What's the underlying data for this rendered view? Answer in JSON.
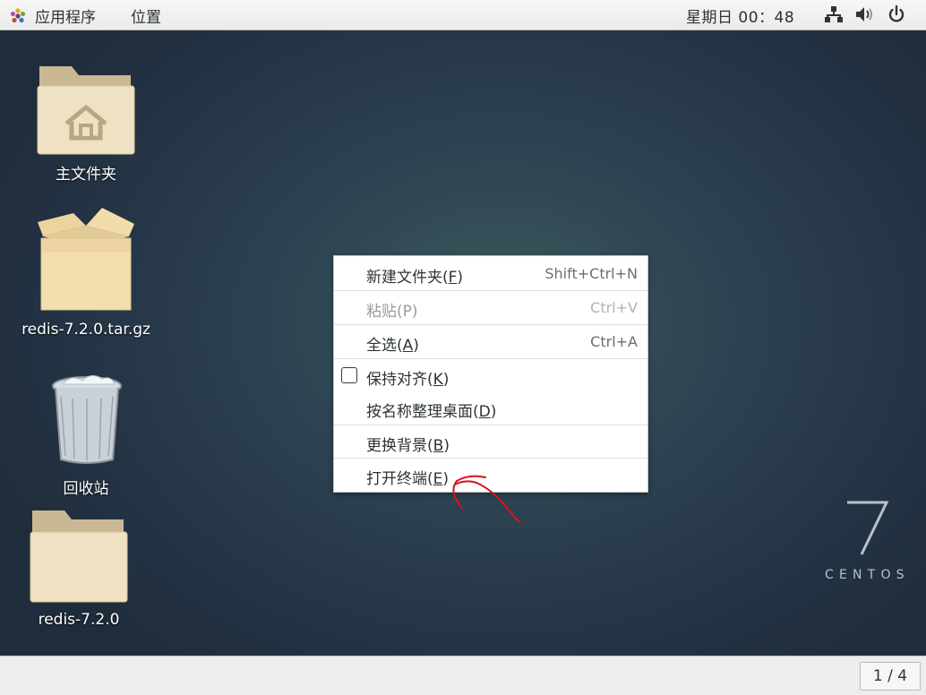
{
  "topbar": {
    "applications_label": "应用程序",
    "places_label": "位置",
    "clock": "星期日 00：48"
  },
  "desktop_icons": [
    {
      "label": "主文件夹",
      "icon": "home-folder-icon"
    },
    {
      "label": "redis-7.2.0.tar.gz",
      "icon": "archive-package-icon"
    },
    {
      "label": "回收站",
      "icon": "trash-icon"
    },
    {
      "label": "redis-7.2.0",
      "icon": "folder-icon"
    }
  ],
  "context_menu": {
    "items": [
      {
        "label": "新建文件夹(",
        "mnemonic": "F",
        "label_end": ")",
        "shortcut": "Shift+Ctrl+N",
        "enabled": true
      },
      {
        "label": "粘贴(P)",
        "mnemonic": "",
        "label_end": "",
        "shortcut": "Ctrl+V",
        "enabled": false
      },
      {
        "label": "全选(",
        "mnemonic": "A",
        "label_end": ")",
        "shortcut": "Ctrl+A",
        "enabled": true
      },
      {
        "label": "保持对齐(",
        "mnemonic": "K",
        "label_end": ")",
        "shortcut": "",
        "enabled": true,
        "checkbox": false
      },
      {
        "label": "按名称整理桌面(",
        "mnemonic": "D",
        "label_end": ")",
        "shortcut": "",
        "enabled": true
      },
      {
        "label": "更换背景(",
        "mnemonic": "B",
        "label_end": ")",
        "shortcut": "",
        "enabled": true
      },
      {
        "label": "打开终端(",
        "mnemonic": "E",
        "label_end": ")",
        "shortcut": "",
        "enabled": true
      }
    ]
  },
  "watermark": {
    "version": "7",
    "brand": "CENTOS"
  },
  "workspace_pager": "1 / 4",
  "colors": {
    "annotation": "#d9121e",
    "topbar_bg": "#f2f2f1",
    "menu_bg": "#ffffff"
  }
}
